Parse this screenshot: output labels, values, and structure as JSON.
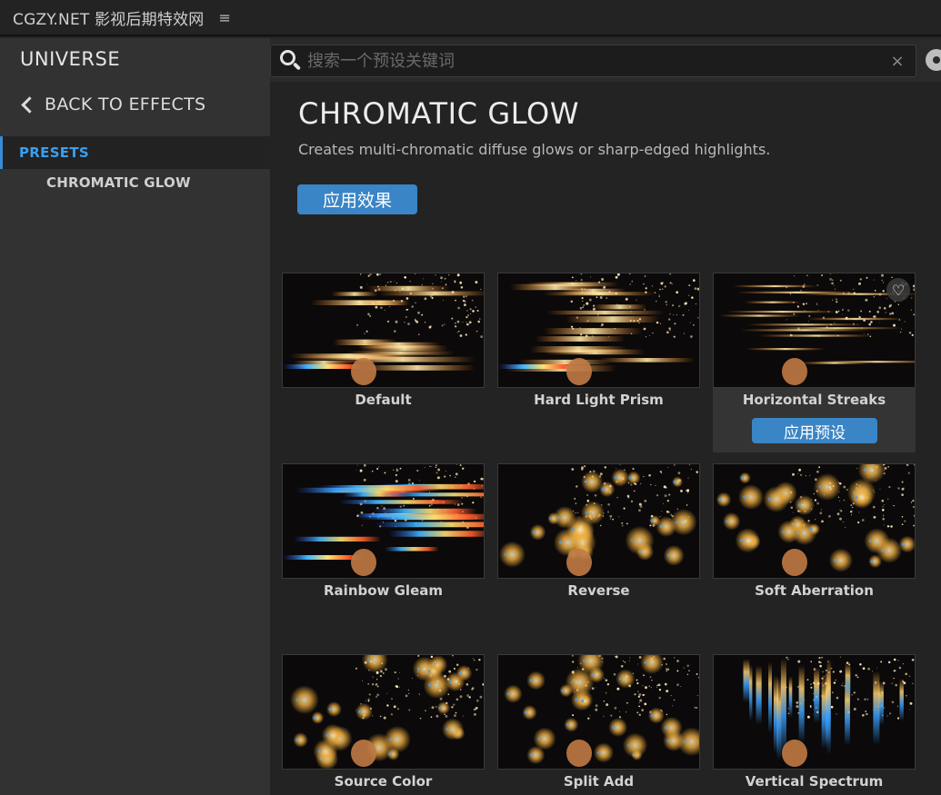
{
  "titlebar": {
    "app_title": "CGZY.NET 影视后期特效网",
    "menu_icon": "≡"
  },
  "sidebar": {
    "brand": "UNIVERSE",
    "back_label": "BACK TO EFFECTS",
    "section_label": "PRESETS",
    "item_label": "CHROMATIC GLOW"
  },
  "search": {
    "placeholder": "搜索一个预设关键词",
    "clear_icon": "×"
  },
  "effect": {
    "title": "CHROMATIC GLOW",
    "description": "Creates multi-chromatic diffuse glows or sharp-edged highlights.",
    "apply_label": "应用效果"
  },
  "presets": [
    {
      "name": "Default",
      "style": "streak"
    },
    {
      "name": "Hard Light Prism",
      "style": "streak-warm"
    },
    {
      "name": "Horizontal Streaks",
      "style": "streak-thin",
      "hovered": true,
      "apply_label": "应用预设",
      "favorite_icon": "heart-icon"
    },
    {
      "name": "Rainbow Gleam",
      "style": "streak-rainbow"
    },
    {
      "name": "Reverse",
      "style": "dots"
    },
    {
      "name": "Soft Aberration",
      "style": "dots-soft"
    },
    {
      "name": "Source Color",
      "style": "dots"
    },
    {
      "name": "Split Add",
      "style": "dots-split"
    },
    {
      "name": "Vertical Spectrum",
      "style": "vertical"
    }
  ],
  "colors": {
    "accent": "#3a85c6",
    "selected_text": "#3aa0ee"
  }
}
